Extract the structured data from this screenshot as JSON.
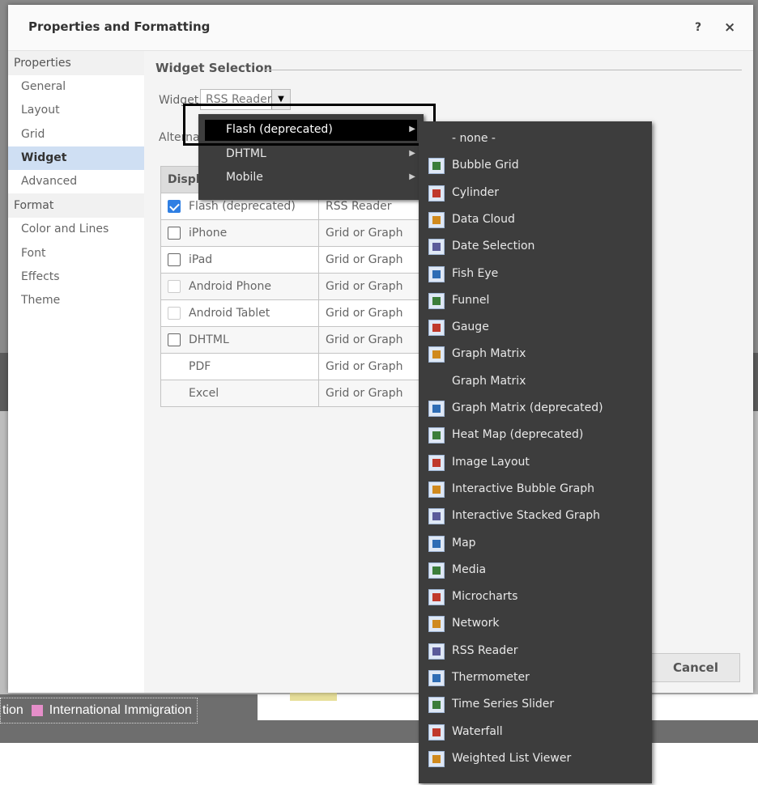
{
  "background": {
    "legend_prefix": "tion",
    "legend_label": "International Immigration",
    "legend_color": "#e58ec9"
  },
  "dialog": {
    "title": "Properties and Formatting",
    "help_glyph": "?",
    "close_glyph": "×",
    "sidebar": {
      "sections": [
        {
          "label": "Properties",
          "items": [
            "General",
            "Layout",
            "Grid",
            "Widget",
            "Advanced"
          ]
        },
        {
          "label": "Format",
          "items": [
            "Color and Lines",
            "Font",
            "Effects",
            "Theme"
          ]
        }
      ],
      "active_item": "Widget"
    },
    "content": {
      "section_title": "Widget Selection",
      "widget_label": "Widget:",
      "widget_value": "RSS Reader",
      "alternate_label": "Alternat",
      "table": {
        "header": "Displa",
        "rows": [
          {
            "device": "Flash (deprecated)",
            "mode": "RSS Reader",
            "checkbox": "checked"
          },
          {
            "device": "iPhone",
            "mode": "Grid or Graph",
            "checkbox": "unchecked"
          },
          {
            "device": "iPad",
            "mode": "Grid or Graph",
            "checkbox": "unchecked"
          },
          {
            "device": "Android Phone",
            "mode": "Grid or Graph",
            "checkbox": "disabled"
          },
          {
            "device": "Android Tablet",
            "mode": "Grid or Graph",
            "checkbox": "disabled"
          },
          {
            "device": "DHTML",
            "mode": "Grid or Graph",
            "checkbox": "unchecked"
          },
          {
            "device": "PDF",
            "mode": "Grid or Graph",
            "checkbox": "none"
          },
          {
            "device": "Excel",
            "mode": "Grid or Graph",
            "checkbox": "none"
          }
        ]
      }
    },
    "cancel_label": "Cancel"
  },
  "submenu_1": {
    "items": [
      "Flash (deprecated)",
      "DHTML",
      "Mobile"
    ],
    "selected": "Flash (deprecated)"
  },
  "submenu_2": {
    "items": [
      {
        "label": "- none -",
        "icon": ""
      },
      {
        "label": "Bubble Grid",
        "icon": "bubble-grid-icon"
      },
      {
        "label": "Cylinder",
        "icon": "cylinder-icon"
      },
      {
        "label": "Data Cloud",
        "icon": "data-cloud-icon"
      },
      {
        "label": "Date Selection",
        "icon": "date-selection-icon"
      },
      {
        "label": "Fish Eye",
        "icon": "fish-eye-icon"
      },
      {
        "label": "Funnel",
        "icon": "funnel-icon"
      },
      {
        "label": "Gauge",
        "icon": "gauge-icon"
      },
      {
        "label": "Graph Matrix",
        "icon": "graph-matrix-icon"
      },
      {
        "label": "Graph Matrix",
        "icon": ""
      },
      {
        "label": "Graph Matrix (deprecated)",
        "icon": "graph-matrix-deprecated-icon"
      },
      {
        "label": "Heat Map (deprecated)",
        "icon": "heat-map-icon"
      },
      {
        "label": "Image Layout",
        "icon": "image-layout-icon"
      },
      {
        "label": "Interactive Bubble Graph",
        "icon": "interactive-bubble-graph-icon"
      },
      {
        "label": "Interactive Stacked Graph",
        "icon": "interactive-stacked-graph-icon"
      },
      {
        "label": "Map",
        "icon": "map-icon"
      },
      {
        "label": "Media",
        "icon": "media-icon"
      },
      {
        "label": "Microcharts",
        "icon": "microcharts-icon"
      },
      {
        "label": "Network",
        "icon": "network-icon"
      },
      {
        "label": "RSS Reader",
        "icon": "rss-reader-icon"
      },
      {
        "label": "Thermometer",
        "icon": "thermometer-icon"
      },
      {
        "label": "Time Series Slider",
        "icon": "time-series-slider-icon"
      },
      {
        "label": "Waterfall",
        "icon": "waterfall-icon"
      },
      {
        "label": "Weighted List Viewer",
        "icon": "weighted-list-viewer-icon"
      }
    ]
  },
  "icon_colors": [
    "#2f6db5",
    "#3b7d3a",
    "#c0392b",
    "#d08a1e",
    "#5b5b9a"
  ]
}
